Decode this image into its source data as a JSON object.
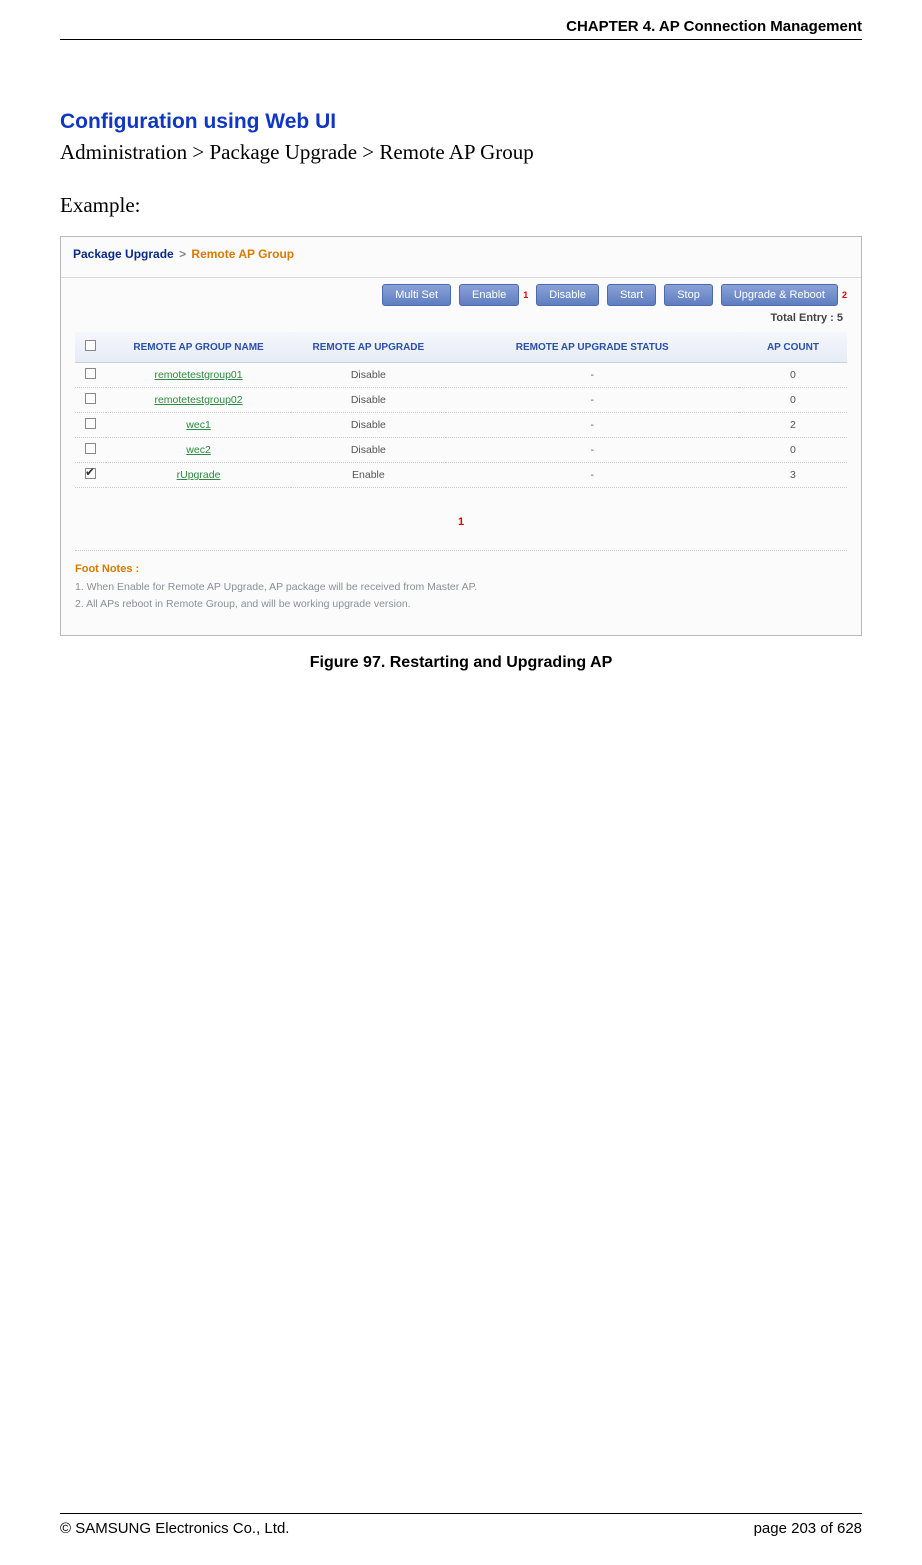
{
  "header": {
    "chapter": "CHAPTER 4. AP Connection Management"
  },
  "section_title": "Configuration using Web UI",
  "nav_path": "Administration > Package Upgrade > Remote AP Group",
  "example_label": "Example:",
  "figure": {
    "breadcrumb": {
      "part1": "Package Upgrade",
      "sep": ">",
      "part2": "Remote AP Group"
    },
    "buttons": {
      "multi_set": "Multi Set",
      "enable": "Enable",
      "disable": "Disable",
      "start": "Start",
      "stop": "Stop",
      "upgrade_reboot": "Upgrade & Reboot"
    },
    "sup1": "1",
    "sup2": "2",
    "total_entry": "Total Entry : 5",
    "columns": {
      "name": "REMOTE AP GROUP NAME",
      "upgrade": "REMOTE AP UPGRADE",
      "status": "REMOTE AP UPGRADE STATUS",
      "count": "AP COUNT"
    },
    "rows": [
      {
        "checked": false,
        "name": "remotetestgroup01",
        "upgrade": "Disable",
        "status": "-",
        "count": "0"
      },
      {
        "checked": false,
        "name": "remotetestgroup02",
        "upgrade": "Disable",
        "status": "-",
        "count": "0"
      },
      {
        "checked": false,
        "name": "wec1",
        "upgrade": "Disable",
        "status": "-",
        "count": "2"
      },
      {
        "checked": false,
        "name": "wec2",
        "upgrade": "Disable",
        "status": "-",
        "count": "0"
      },
      {
        "checked": true,
        "name": "rUpgrade",
        "upgrade": "Enable",
        "status": "-",
        "count": "3"
      }
    ],
    "pager": "1",
    "footnotes": {
      "title": "Foot Notes :",
      "items": [
        "1. When Enable for Remote AP Upgrade, AP package will be received from Master AP.",
        "2. All APs reboot in Remote Group, and will be working upgrade version."
      ]
    }
  },
  "figure_caption": "Figure 97. Restarting and Upgrading AP",
  "footer": {
    "copyright": "© SAMSUNG Electronics Co., Ltd.",
    "page": "page 203 of 628"
  }
}
